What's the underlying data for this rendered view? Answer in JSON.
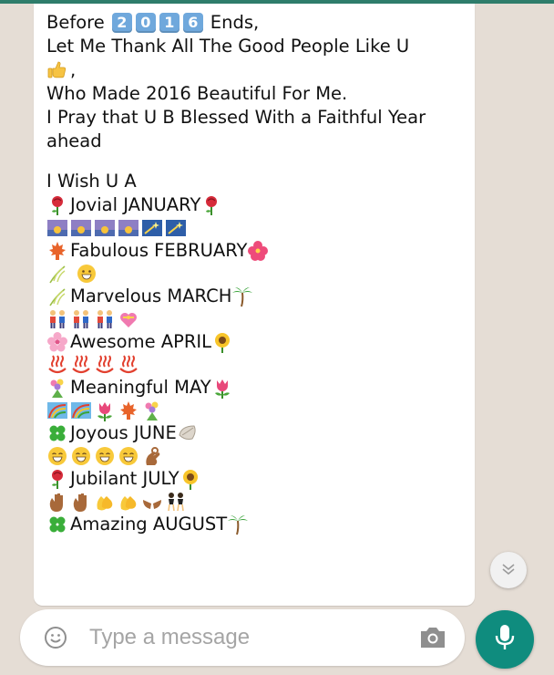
{
  "message": {
    "line1_before": "Before",
    "year_digits": [
      "2",
      "0",
      "1",
      "6"
    ],
    "line1_after": "Ends,",
    "line2": "Let Me Thank All The Good People Like U",
    "line3_text": ",",
    "line4": "Who Made 2016 Beautiful For Me.",
    "line5": "I Pray that U B Blessed With a Faithful Year",
    "line6": "ahead",
    "line7": "I Wish U A",
    "months": [
      {
        "label": "Jovial  JANUARY"
      },
      {
        "label": "Fabulous FEBRUARY"
      },
      {
        "label": "Marvelous MARCH"
      },
      {
        "label": "Awesome APRIL"
      },
      {
        "label": "Meaningful MAY"
      },
      {
        "label": "Joyous  JUNE"
      },
      {
        "label": "Jubilant JULY"
      },
      {
        "label": "Amazing AUGUST"
      }
    ]
  },
  "composer": {
    "placeholder": "Type a message"
  },
  "icons": {
    "emoji_button": "smiley-icon",
    "camera_button": "camera-icon",
    "send_button": "mic-icon",
    "scroll_down": "double-chevron-down-icon"
  },
  "colors": {
    "accent": "#0f8c7e",
    "chat_background": "#e5ddd5",
    "bubble": "#ffffff",
    "keycap": "#6fa8dc"
  }
}
